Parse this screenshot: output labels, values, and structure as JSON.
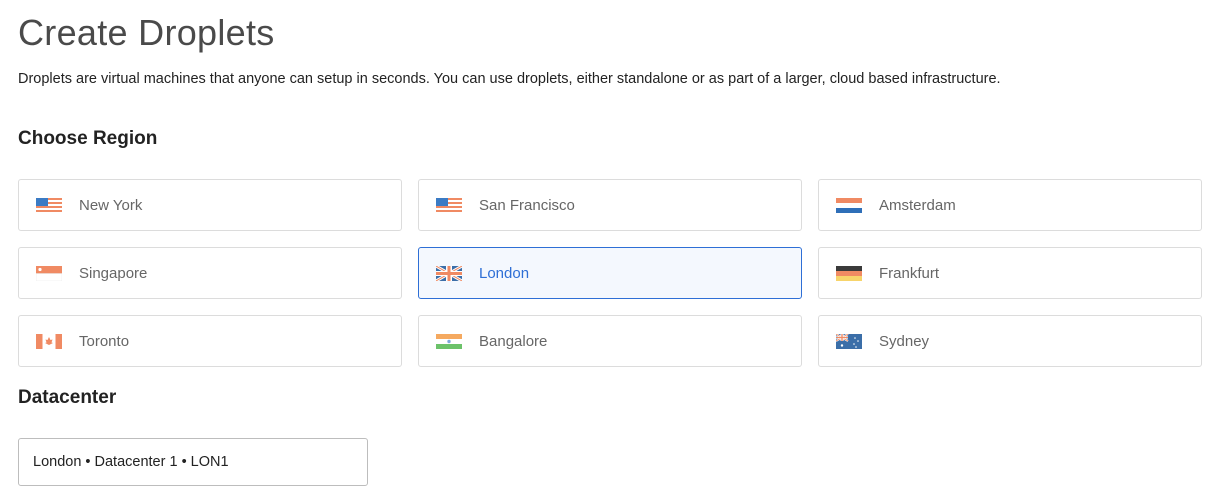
{
  "page": {
    "title": "Create Droplets",
    "description": "Droplets are virtual machines that anyone can setup in seconds. You can use droplets, either standalone or as part of a larger, cloud based infrastructure."
  },
  "region": {
    "heading": "Choose Region",
    "selected": "London",
    "accent_color": "#2e6fd6",
    "options": [
      {
        "label": "New York",
        "flag": "us-flag-icon"
      },
      {
        "label": "San Francisco",
        "flag": "us-flag-icon"
      },
      {
        "label": "Amsterdam",
        "flag": "netherlands-flag-icon"
      },
      {
        "label": "Singapore",
        "flag": "singapore-flag-icon"
      },
      {
        "label": "London",
        "flag": "uk-flag-icon"
      },
      {
        "label": "Frankfurt",
        "flag": "germany-flag-icon"
      },
      {
        "label": "Toronto",
        "flag": "canada-flag-icon"
      },
      {
        "label": "Bangalore",
        "flag": "india-flag-icon"
      },
      {
        "label": "Sydney",
        "flag": "australia-flag-icon"
      }
    ]
  },
  "datacenter": {
    "heading": "Datacenter",
    "value": "London • Datacenter 1 • LON1"
  }
}
